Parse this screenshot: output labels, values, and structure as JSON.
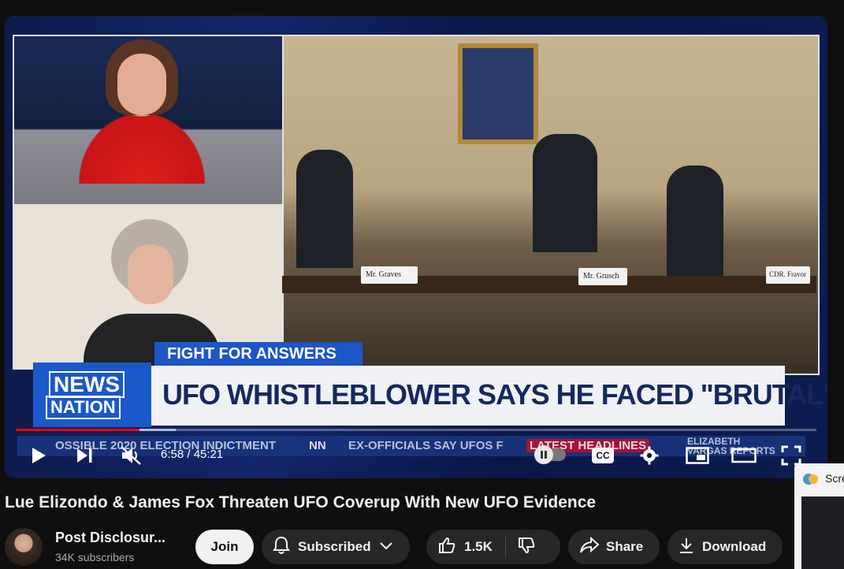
{
  "video": {
    "overlay": {
      "network_logo_line1": "NEWS",
      "network_logo_line2": "NATION",
      "lower_third_label": "FIGHT FOR ANSWERS",
      "headline": "UFO WHISTLEBLOWER SAYS HE FACED \"BRUTAL\" RETALIATION",
      "ticker_left": "OSSIBLE 2020 ELECTION INDICTMENT",
      "ticker_nn": "NN",
      "ticker_mid": "EX-OFFICIALS SAY UFOS F",
      "ticker_latest": "LATEST HEADLINES",
      "ticker_right": "ELIZABETH VARGAS REPORTS",
      "nameplate_1": "Mr. Graves",
      "nameplate_2": "Mr. Grusch",
      "nameplate_3": "CDR. Fravor"
    },
    "progress": {
      "played_fraction": 0.155,
      "buffered_fraction": 0.2
    },
    "time_display": "6:58 / 45:21",
    "cc_label": "CC"
  },
  "title": "Lue Elizondo & James Fox Threaten UFO Coverup With New UFO Evidence",
  "channel": {
    "name": "Post Disclosur...",
    "subscribers": "34K subscribers"
  },
  "actions": {
    "join": "Join",
    "subscribed": "Subscribed",
    "likes": "1.5K",
    "share": "Share",
    "download": "Download"
  },
  "side_card": {
    "label": "Scre"
  }
}
